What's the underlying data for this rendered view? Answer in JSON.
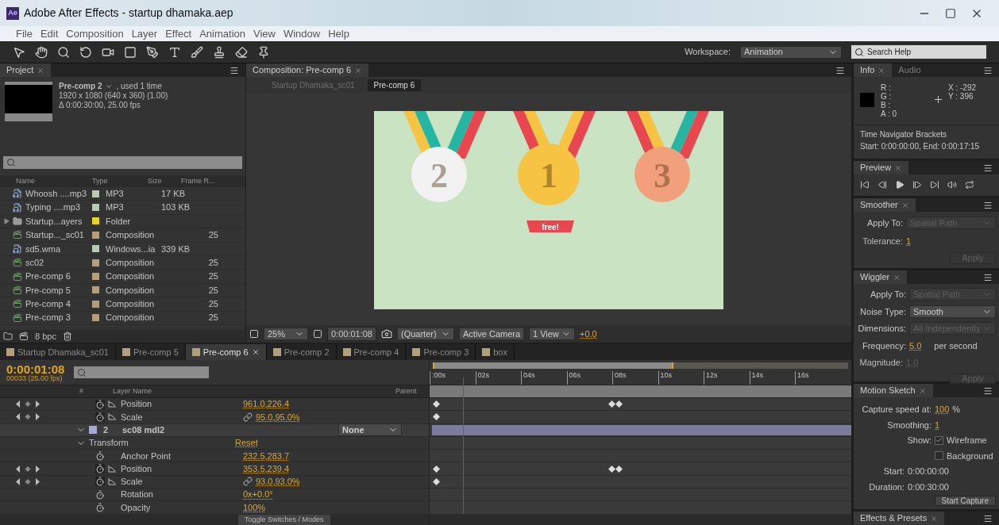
{
  "window": {
    "app_badge": "Ae",
    "title": "Adobe After Effects - startup dhamaka.aep"
  },
  "menu": [
    "File",
    "Edit",
    "Composition",
    "Layer",
    "Effect",
    "Animation",
    "View",
    "Window",
    "Help"
  ],
  "toolbar": {
    "workspace_label": "Workspace:",
    "workspace": "Animation",
    "search_placeholder": "Search Help"
  },
  "project": {
    "tab": "Project",
    "item_name": "Pre-comp 2",
    "item_used": ", used 1 time",
    "item_size": "1920 x 1080  (640 x 360) (1.00)",
    "item_duration": "Δ 0:00:30:00, 25.00 fps",
    "columns": [
      "Name",
      "Type",
      "Size",
      "Frame R..."
    ],
    "rows": [
      {
        "kind": "audio",
        "name": "Whoosh ....mp3",
        "color": "#b8c9b4",
        "type": "MP3",
        "size": "17 KB"
      },
      {
        "kind": "audio",
        "name": "Typing ....mp3",
        "color": "#b8c9b4",
        "type": "MP3",
        "size": "103 KB"
      },
      {
        "kind": "folder",
        "name": "Startup...ayers",
        "color": "#e8d52a",
        "type": "Folder"
      },
      {
        "kind": "comp",
        "name": "Startup..._sc01",
        "color": "#b39f7c",
        "type": "Composition",
        "rate": "25"
      },
      {
        "kind": "audio",
        "name": "sd5.wma",
        "color": "#b8c9b4",
        "type": "Windows...ia",
        "size": "339 KB"
      },
      {
        "kind": "comp",
        "name": "sc02",
        "color": "#b39f7c",
        "type": "Composition",
        "rate": "25"
      },
      {
        "kind": "comp",
        "name": "Pre-comp 6",
        "color": "#b39f7c",
        "type": "Composition",
        "rate": "25"
      },
      {
        "kind": "comp",
        "name": "Pre-comp 5",
        "color": "#b39f7c",
        "type": "Composition",
        "rate": "25"
      },
      {
        "kind": "comp",
        "name": "Pre-comp 4",
        "color": "#b39f7c",
        "type": "Composition",
        "rate": "25"
      },
      {
        "kind": "comp",
        "name": "Pre-comp 3",
        "color": "#b39f7c",
        "type": "Composition",
        "rate": "25"
      }
    ],
    "bpc": "8 bpc"
  },
  "composition": {
    "tab": "Composition: Pre-comp 6",
    "breadcrumbs": [
      {
        "label": "Startup Dhamaka_sc01",
        "selected": false
      },
      {
        "label": "Pre-comp 6",
        "selected": true
      }
    ],
    "medals": [
      {
        "number": "2",
        "color": "#f2f2f2"
      },
      {
        "number": "1",
        "color": "#f6c343"
      },
      {
        "number": "3",
        "color": "#f2a07b"
      }
    ],
    "ribbon": "free!",
    "zoom": "25%",
    "timecode": "0:00:01:08",
    "resolution": "(Quarter)",
    "camera": "Active Camera",
    "views": "1 View",
    "exposure": "+0.0"
  },
  "timeline": {
    "tabs": [
      {
        "label": "Startup Dhamaka_sc01",
        "selected": false
      },
      {
        "label": "Pre-comp 5",
        "selected": false
      },
      {
        "label": "Pre-comp 6",
        "selected": true
      },
      {
        "label": "Pre-comp 2",
        "selected": false
      },
      {
        "label": "Pre-comp 4",
        "selected": false
      },
      {
        "label": "Pre-comp 3",
        "selected": false
      },
      {
        "label": "box",
        "selected": false
      }
    ],
    "time": "0:00:01:08",
    "frame": "00033 (25.00 fps)",
    "number_header": "#",
    "name_header": "Layer Name",
    "parent_header": "Parent",
    "ruler": [
      ":00s",
      "02s",
      "04s",
      "06s",
      "08s",
      "10s",
      "12s",
      "14s",
      "16s"
    ],
    "rows": [
      {
        "kind": "property",
        "name": "Position",
        "value": "961.0,226.4",
        "animated": true,
        "mid_keyframes": true
      },
      {
        "kind": "property",
        "name": "Scale",
        "value": "95.0,95.0%",
        "linked": true,
        "animated": true,
        "mid_keyframes": false
      },
      {
        "kind": "layer",
        "number": "2",
        "name": "sc08 mdl2",
        "parent": "None",
        "expanded": true
      },
      {
        "kind": "group",
        "name": "Transform",
        "value": "Reset",
        "expanded": true
      },
      {
        "kind": "property",
        "name": "Anchor Point",
        "value": "232.5,283.7",
        "animated": false
      },
      {
        "kind": "property",
        "name": "Position",
        "value": "353.5,239.4",
        "animated": true,
        "mid_keyframes": true
      },
      {
        "kind": "property",
        "name": "Scale",
        "value": "93.0,93.0%",
        "linked": true,
        "animated": true,
        "mid_keyframes": false
      },
      {
        "kind": "property",
        "name": "Rotation",
        "value": "0x+0.0°",
        "animated": false
      },
      {
        "kind": "property",
        "name": "Opacity",
        "value": "100%",
        "animated": false
      }
    ],
    "toggle": "Toggle Switches / Modes"
  },
  "info": {
    "tab": "Info",
    "tab2": "Audio",
    "channels": [
      "R :",
      "G :",
      "B :",
      "A : 0"
    ],
    "x": "X : -292",
    "y": "Y : 396",
    "note_title": "Time Navigator Brackets",
    "note": "Start: 0:00:00:00, End: 0:00:17:15"
  },
  "preview": {
    "tab": "Preview"
  },
  "smoother": {
    "tab": "Smoother",
    "apply_to_label": "Apply To:",
    "apply_to": "Spatial Path",
    "apply_to_disabled": true,
    "tolerance_label": "Tolerance:",
    "tolerance": "1",
    "apply": "Apply",
    "apply_disabled": true
  },
  "wiggler": {
    "tab": "Wiggler",
    "apply_to_label": "Apply To:",
    "apply_to": "Spatial Path",
    "apply_to_disabled": true,
    "noise_label": "Noise Type:",
    "noise": "Smooth",
    "noise_disabled": false,
    "dimensions_label": "Dimensions:",
    "dimensions": "All Independently",
    "dimensions_disabled": true,
    "frequency_label": "Frequency:",
    "frequency": "5.0",
    "frequency_unit": "per second",
    "magnitude_label": "Magnitude:",
    "magnitude": "1.0",
    "apply": "Apply",
    "apply_disabled": true
  },
  "motion_sketch": {
    "tab": "Motion Sketch",
    "speed_label": "Capture speed at:",
    "speed": "100",
    "speed_unit": "%",
    "smoothing_label": "Smoothing:",
    "smoothing": "1",
    "show_label": "Show:",
    "checkboxes": [
      {
        "label": "Wireframe",
        "checked": true
      },
      {
        "label": "Background",
        "checked": false
      }
    ],
    "start_label": "Start:",
    "start": "0:00:00:00",
    "duration_label": "Duration:",
    "duration": "0:00:30:00",
    "capture": "Start Capture"
  },
  "effects": {
    "tab": "Effects & Presets"
  }
}
